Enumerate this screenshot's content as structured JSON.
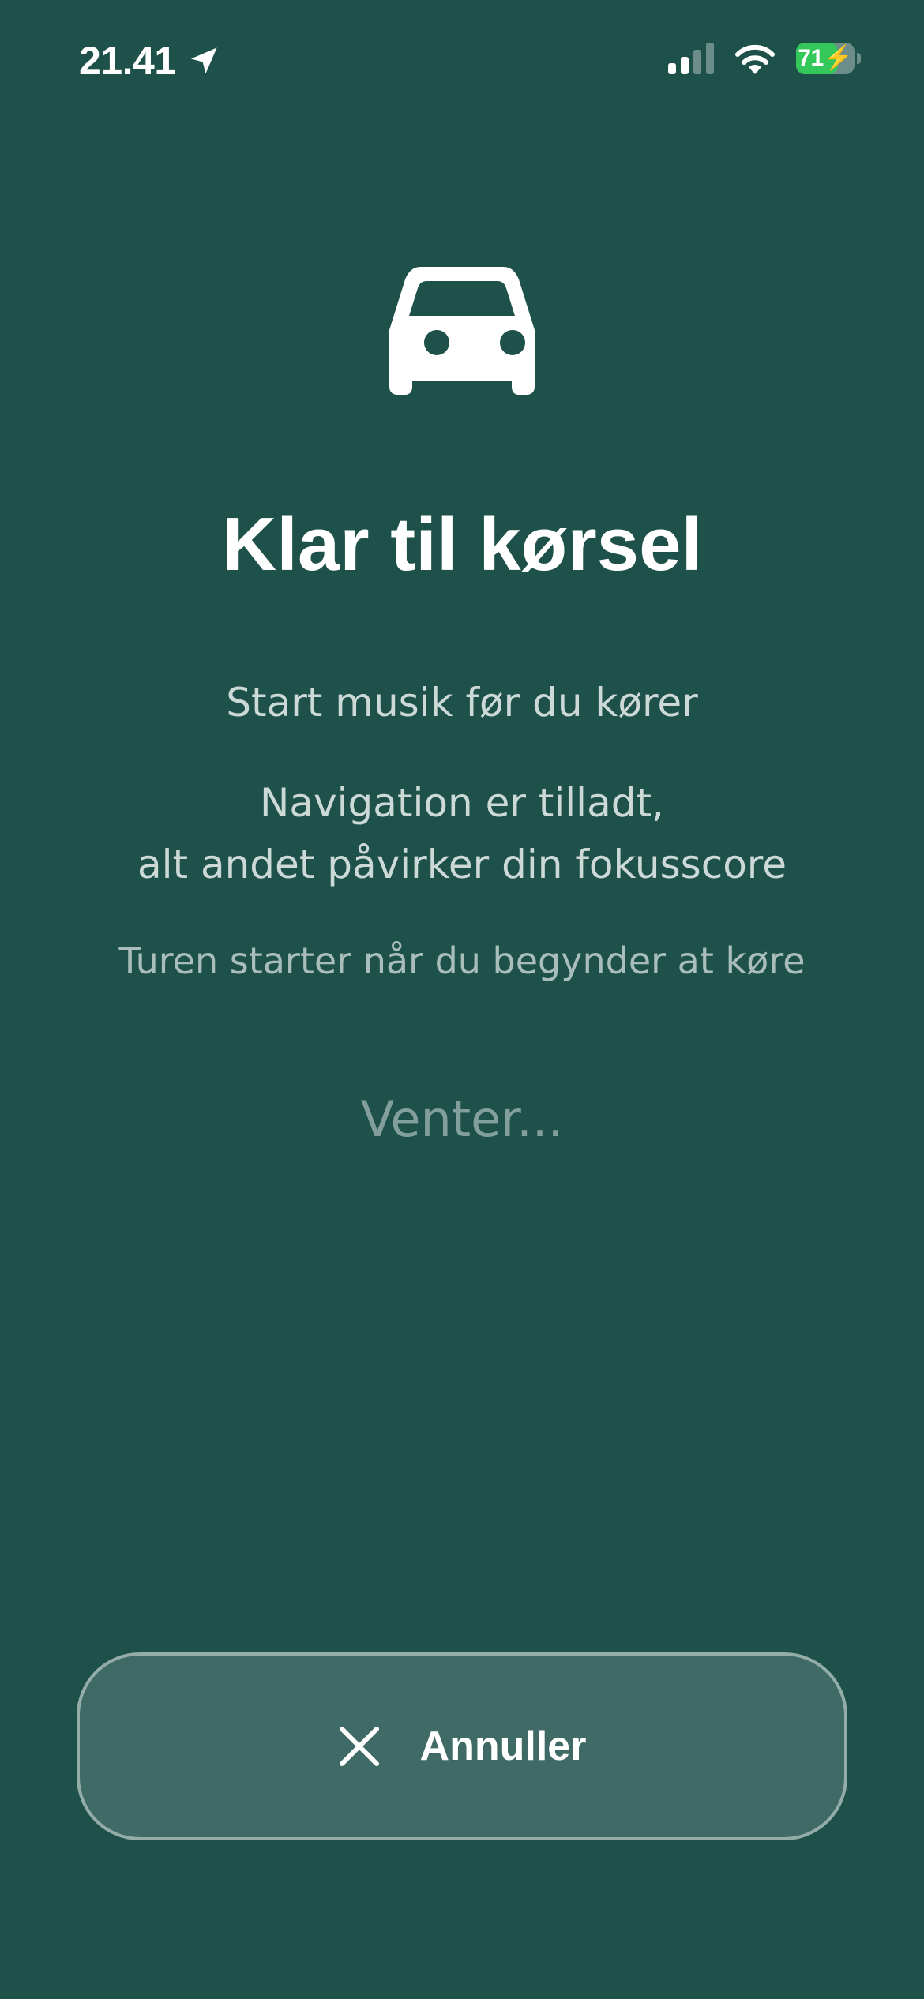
{
  "status_bar": {
    "time": "21.41",
    "battery_level": "71",
    "battery_fraction": 0.71,
    "icons": [
      "location-arrow-icon",
      "cellular-signal-icon",
      "wifi-icon",
      "battery-charging-icon"
    ]
  },
  "main": {
    "icon": "car-icon",
    "title": "Klar til kørsel",
    "instruction_music": "Start musik før du kører",
    "instruction_navigation_1": "Navigation er tilladt,",
    "instruction_navigation_2": "alt andet påvirker din fokusscore",
    "trip_start_note": "Turen starter når du begynder at køre",
    "status": "Venter..."
  },
  "cancel_button": {
    "icon": "close-icon",
    "label": "Annuller"
  },
  "colors": {
    "background": "#1e514a",
    "battery_green": "#34c759",
    "text_primary": "#ffffff"
  }
}
